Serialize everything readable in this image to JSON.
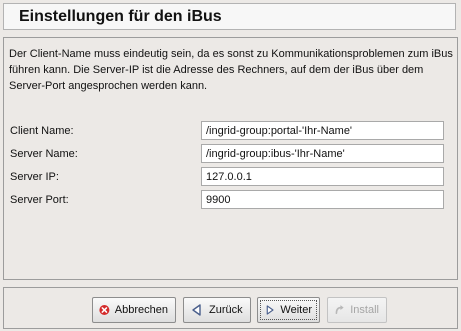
{
  "header": {
    "title": "Einstellungen für den iBus"
  },
  "description": "Der Client-Name muss eindeutig sein, da es sonst zu Kommunikationsproblemen zum iBus führen kann. Die Server-IP ist die Adresse des Rechners, auf dem der iBus über dem Server-Port angesprochen werden kann.",
  "form": {
    "client_name": {
      "label": "Client Name:",
      "value": "/ingrid-group:portal-'Ihr-Name'"
    },
    "server_name": {
      "label": "Server Name:",
      "value": "/ingrid-group:ibus-'Ihr-Name'"
    },
    "server_ip": {
      "label": "Server IP:",
      "value": "127.0.0.1"
    },
    "server_port": {
      "label": "Server Port:",
      "value": "9900"
    }
  },
  "buttons": {
    "cancel": {
      "label": "Abbrechen",
      "icon": "cancel-icon"
    },
    "back": {
      "label": "Zurück",
      "icon": "back-arrow-icon"
    },
    "next": {
      "label": "Weiter",
      "icon": "next-arrow-icon"
    },
    "install": {
      "label": "Install",
      "icon": "install-icon",
      "enabled": false
    }
  },
  "colors": {
    "cancel_red": "#d42b2b",
    "arrow_blue": "#4a5f8c",
    "disabled_gray": "#a5a5a5"
  }
}
